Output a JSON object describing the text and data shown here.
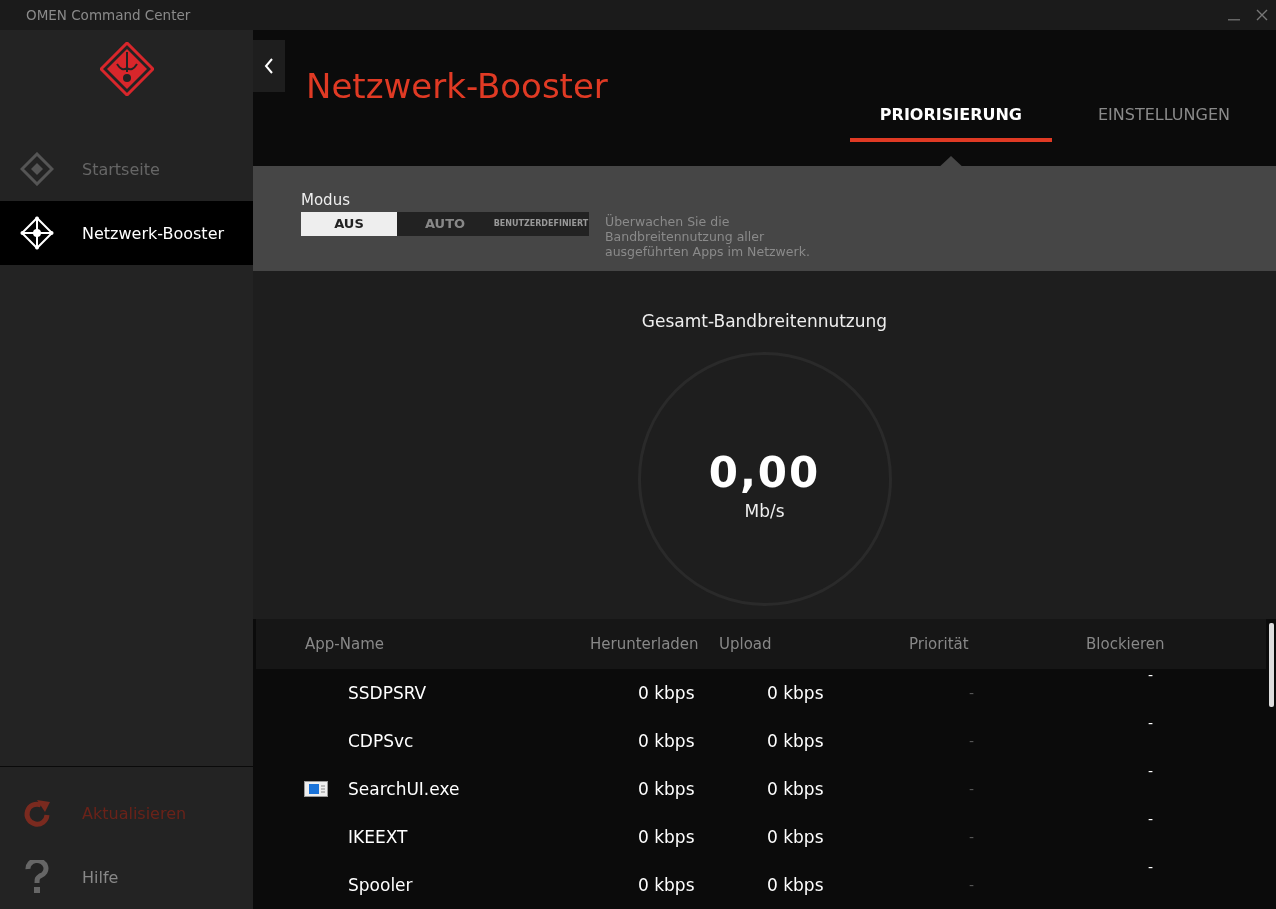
{
  "window": {
    "title": "OMEN Command Center"
  },
  "sidebar": {
    "items": [
      {
        "label": "Startseite",
        "kind": "home",
        "selected": false
      },
      {
        "label": "Netzwerk-Booster",
        "kind": "network",
        "selected": true
      }
    ],
    "bottom_items": [
      {
        "label": "Aktualisieren",
        "kind": "update",
        "disabled": true
      },
      {
        "label": "Hilfe",
        "kind": "help",
        "disabled": false
      }
    ]
  },
  "page": {
    "title": "Netzwerk-Booster"
  },
  "tabs": [
    {
      "label": "PRIORISIERUNG",
      "selected": true
    },
    {
      "label": "EINSTELLUNGEN",
      "selected": false
    }
  ],
  "mode": {
    "label": "Modus",
    "options": [
      {
        "label": "AUS",
        "selected": true,
        "kind": "normal"
      },
      {
        "label": "AUTO",
        "selected": false,
        "kind": "normal"
      },
      {
        "label": "BENUTZERDEFINIERT",
        "selected": false,
        "kind": "small"
      }
    ],
    "description": "Überwachen Sie die Bandbreitennutzung aller ausgeführten Apps im Netzwerk."
  },
  "gauge": {
    "title": "Gesamt-Bandbreitennutzung",
    "value": "0,00",
    "unit": "Mb/s"
  },
  "table": {
    "columns": [
      "App-Name",
      "Herunterladen",
      "Upload",
      "Priorität",
      "Blockieren"
    ],
    "rows": [
      {
        "has_icon": false,
        "name": "SSDPSRV",
        "download": "0 kbps",
        "upload": "0 kbps",
        "priority": "-",
        "block": "-"
      },
      {
        "has_icon": false,
        "name": "CDPSvc",
        "download": "0 kbps",
        "upload": "0 kbps",
        "priority": "-",
        "block": "-"
      },
      {
        "has_icon": true,
        "name": "SearchUI.exe",
        "download": "0 kbps",
        "upload": "0 kbps",
        "priority": "-",
        "block": "-"
      },
      {
        "has_icon": false,
        "name": "IKEEXT",
        "download": "0 kbps",
        "upload": "0 kbps",
        "priority": "-",
        "block": "-"
      },
      {
        "has_icon": false,
        "name": "Spooler",
        "download": "0 kbps",
        "upload": "0 kbps",
        "priority": "-",
        "block": "-"
      }
    ]
  }
}
